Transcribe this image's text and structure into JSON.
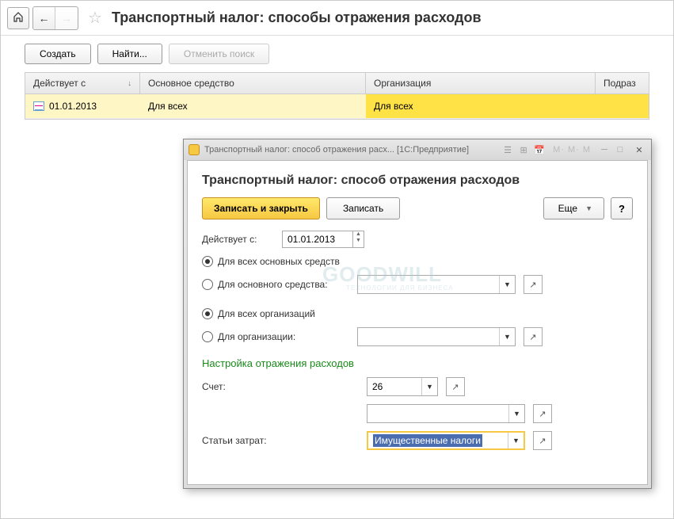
{
  "page": {
    "title": "Транспортный налог: способы отражения расходов"
  },
  "toolbar": {
    "create": "Создать",
    "find": "Найти...",
    "cancel_search": "Отменить поиск"
  },
  "table": {
    "headers": {
      "valid_from": "Действует с",
      "sort_arrow": "↓",
      "asset": "Основное средство",
      "org": "Организация",
      "dept": "Подраз"
    },
    "row": {
      "date": "01.01.2013",
      "asset": "Для всех",
      "org": "Для всех"
    }
  },
  "dialog": {
    "window_title": "Транспортный налог: способ отражения расх...  [1С:Предприятие]",
    "wm_small": "M· M· M",
    "heading": "Транспортный налог: способ отражения расходов",
    "actions": {
      "save_close": "Записать и закрыть",
      "save": "Записать",
      "more": "Еще",
      "help": "?"
    },
    "valid_from_label": "Действует с:",
    "valid_from_value": "01.01.2013",
    "radios": {
      "all_assets": "Для всех основных средств",
      "for_asset": "Для основного средства:",
      "all_orgs": "Для всех организаций",
      "for_org": "Для организации:"
    },
    "section": "Настройка отражения расходов",
    "account_label": "Счет:",
    "account_value": "26",
    "cost_label": "Статьи затрат:",
    "cost_value": "Имущественные налоги"
  },
  "watermark": {
    "big": "GOODWILL",
    "sub": "ТЕХНОЛОГИИ ДЛЯ БИЗНЕСА"
  }
}
